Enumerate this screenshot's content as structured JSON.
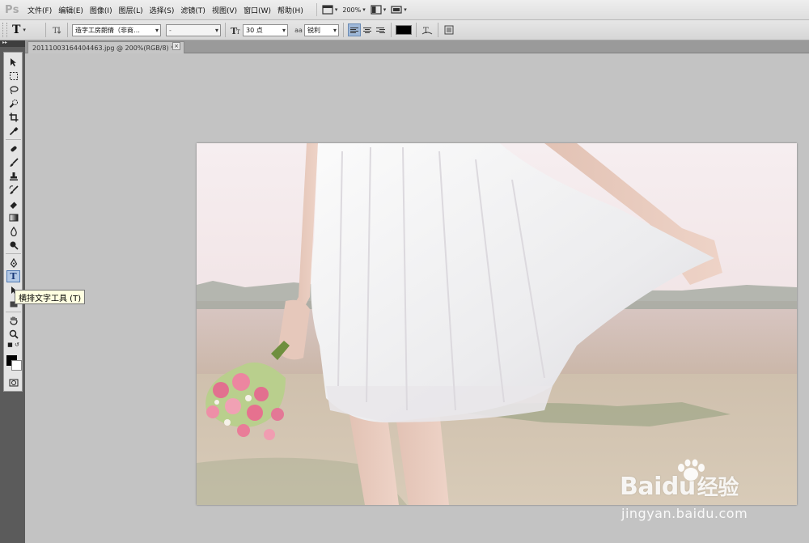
{
  "app": {
    "logo": "Ps"
  },
  "menu": {
    "items": [
      "文件(F)",
      "编辑(E)",
      "图像(I)",
      "图层(L)",
      "选择(S)",
      "滤镜(T)",
      "视图(V)",
      "窗口(W)",
      "帮助(H)"
    ],
    "zoom": "200%"
  },
  "options": {
    "font_family": "造字工房朗倩（非商…",
    "font_style": "-",
    "font_size": "30 点",
    "aa_icon_label": "aa",
    "antialias": "锐利",
    "text_color": "#000000"
  },
  "document": {
    "tab_title": "20111003164404463.jpg @ 200%(RGB/8) *"
  },
  "tooltip": {
    "text": "横排文字工具 (T)"
  },
  "tools": {
    "active": "horizontal-type-tool"
  },
  "watermark": {
    "logo_text": "Bai",
    "logo_du": "du",
    "logo_cn": "经验",
    "url": "jingyan.baidu.com"
  }
}
